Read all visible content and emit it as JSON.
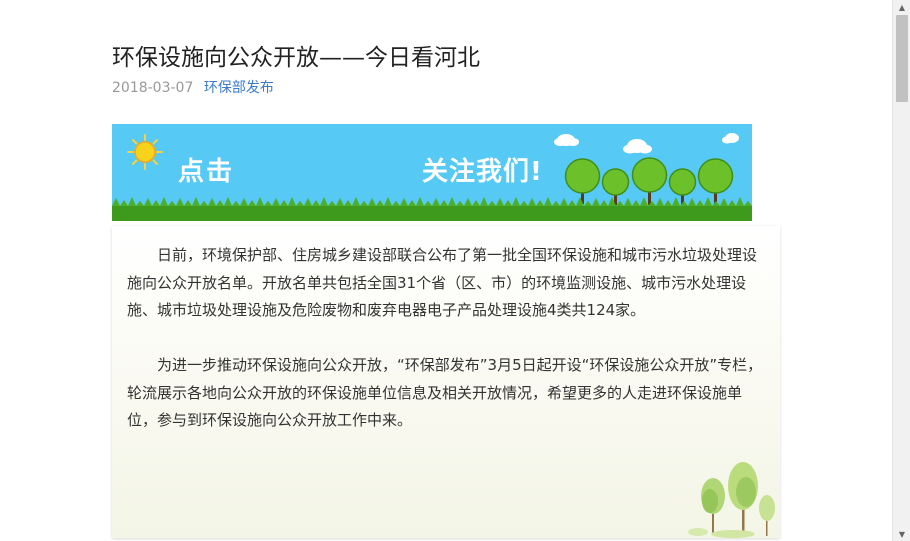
{
  "article": {
    "title": "环保设施向公众开放——今日看河北",
    "date": "2018-03-07",
    "source": "环保部发布",
    "banner": {
      "text_left": "点击",
      "text_right": "关注我们!"
    },
    "paragraphs": [
      "日前，环境保护部、住房城乡建设部联合公布了第一批全国环保设施和城市污水垃圾处理设施向公众开放名单。开放名单共包括全国31个省（区、市）的环境监测设施、城市污水处理设施、城市垃圾处理设施及危险废物和废弃电器电子产品处理设施4类共124家。",
      "为进一步推动环保设施向公众开放，“环保部发布”3月5日起开设“环保设施公众开放”专栏，轮流展示各地向公众开放的环保设施单位信息及相关开放情况，希望更多的人走进环保设施单位，参与到环保设施向公众开放工作中来。"
    ]
  },
  "colors": {
    "banner_sky": "#57c9f5",
    "grass": "#3d9a1c",
    "source_link": "#3b7cc9"
  },
  "icons": {
    "sun": "sun-icon",
    "cloud": "cloud-icon",
    "tree": "tree-icon"
  }
}
